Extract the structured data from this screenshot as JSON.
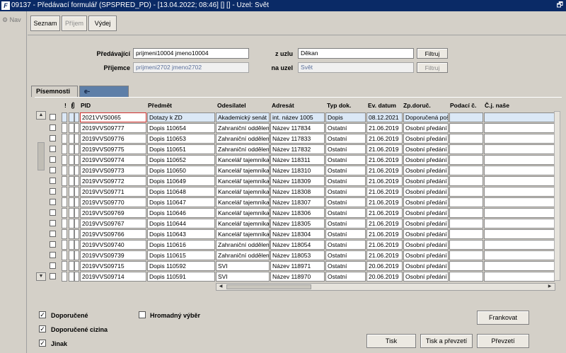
{
  "window": {
    "title": "09137 - Předávací formulář (SPSPRED_PD) - [13.04.2022; 08:46] [] [] - Uzel: Svět",
    "icon_label": "F"
  },
  "leftnav": {
    "label": "Nav"
  },
  "toolbar": {
    "seznam": "Seznam",
    "prijem": "Příjem",
    "vydej": "Výdej"
  },
  "form": {
    "predavajici_label": "Předávající",
    "predavajici_value": "prijmeni10004 jmeno10004",
    "prijemce_label": "Příjemce",
    "prijemce_value": "prijmeni2702 jmeno2702",
    "zuzlu_label": "z uzlu",
    "zuzlu_value": "Děkan",
    "nauzel_label": "na uzel",
    "nauzel_value": "Svět",
    "filtruj1": "Filtruj",
    "filtruj2": "Filtruj"
  },
  "tabs": [
    {
      "label": "Písemnosti"
    },
    {
      "label": "e-Dokumenty"
    }
  ],
  "columns": {
    "flag": "!",
    "pid": "PID",
    "predmet": "Předmět",
    "odesilatel": "Odesílatel",
    "adresat": "Adresát",
    "typ": "Typ dok.",
    "evdatum": "Ev. datum",
    "zpdoruc": "Zp.doruč.",
    "podaci": "Podací č.",
    "cjnase": "Č.j. naše"
  },
  "rows": [
    {
      "pid": "2021VVS0065",
      "predmet": "Dotazy k ZD",
      "odesilatel": "Akademický senát",
      "adresat": "int. název 1005",
      "typ": "Dopis",
      "datum": "08.12.2021",
      "zp": "Doporučená poš"
    },
    {
      "pid": "2019VVS09777",
      "predmet": "Dopis 110654",
      "odesilatel": "Zahraniční oddělení",
      "adresat": "Název 117834",
      "typ": "Ostatní",
      "datum": "21.06.2019",
      "zp": "Osobní předání"
    },
    {
      "pid": "2019VVS09776",
      "predmet": "Dopis 110653",
      "odesilatel": "Zahraniční oddělení",
      "adresat": "Název 117833",
      "typ": "Ostatní",
      "datum": "21.06.2019",
      "zp": "Osobní předání"
    },
    {
      "pid": "2019VVS09775",
      "predmet": "Dopis 110651",
      "odesilatel": "Zahraniční oddělení",
      "adresat": "Název 117832",
      "typ": "Ostatní",
      "datum": "21.06.2019",
      "zp": "Osobní předání"
    },
    {
      "pid": "2019VVS09774",
      "predmet": "Dopis 110652",
      "odesilatel": "Kancelář tajemníka",
      "adresat": "Název 118311",
      "typ": "Ostatní",
      "datum": "21.06.2019",
      "zp": "Osobní předání"
    },
    {
      "pid": "2019VVS09773",
      "predmet": "Dopis 110650",
      "odesilatel": "Kancelář tajemníka",
      "adresat": "Název 118310",
      "typ": "Ostatní",
      "datum": "21.06.2019",
      "zp": "Osobní předání"
    },
    {
      "pid": "2019VVS09772",
      "predmet": "Dopis 110649",
      "odesilatel": "Kancelář tajemníka",
      "adresat": "Název 118309",
      "typ": "Ostatní",
      "datum": "21.06.2019",
      "zp": "Osobní předání"
    },
    {
      "pid": "2019VVS09771",
      "predmet": "Dopis 110648",
      "odesilatel": "Kancelář tajemníka",
      "adresat": "Název 118308",
      "typ": "Ostatní",
      "datum": "21.06.2019",
      "zp": "Osobní předání"
    },
    {
      "pid": "2019VVS09770",
      "predmet": "Dopis 110647",
      "odesilatel": "Kancelář tajemníka",
      "adresat": "Název 118307",
      "typ": "Ostatní",
      "datum": "21.06.2019",
      "zp": "Osobní předání"
    },
    {
      "pid": "2019VVS09769",
      "predmet": "Dopis 110646",
      "odesilatel": "Kancelář tajemníka",
      "adresat": "Název 118306",
      "typ": "Ostatní",
      "datum": "21.06.2019",
      "zp": "Osobní předání"
    },
    {
      "pid": "2019VVS09767",
      "predmet": "Dopis 110644",
      "odesilatel": "Kancelář tajemníka",
      "adresat": "Název 118305",
      "typ": "Ostatní",
      "datum": "21.06.2019",
      "zp": "Osobní předání"
    },
    {
      "pid": "2019VVS09766",
      "predmet": "Dopis 110643",
      "odesilatel": "Kancelář tajemníka",
      "adresat": "Název 118304",
      "typ": "Ostatní",
      "datum": "21.06.2019",
      "zp": "Osobní předání"
    },
    {
      "pid": "2019VVS09740",
      "predmet": "Dopis 110616",
      "odesilatel": "Zahraniční oddělení",
      "adresat": "Název 118054",
      "typ": "Ostatní",
      "datum": "21.06.2019",
      "zp": "Osobní předání"
    },
    {
      "pid": "2019VVS09739",
      "predmet": "Dopis 110615",
      "odesilatel": "Zahraniční oddělení",
      "adresat": "Název 118053",
      "typ": "Ostatní",
      "datum": "21.06.2019",
      "zp": "Osobní předání"
    },
    {
      "pid": "2019VVS09715",
      "predmet": "Dopis 110592",
      "odesilatel": "SVI",
      "adresat": "Název 118971",
      "typ": "Ostatní",
      "datum": "20.06.2019",
      "zp": "Osobní předání"
    },
    {
      "pid": "2019VVS09714",
      "predmet": "Dopis 110591",
      "odesilatel": "SVI",
      "adresat": "Název 118970",
      "typ": "Ostatní",
      "datum": "20.06.2019",
      "zp": "Osobní předání"
    }
  ],
  "bottom": {
    "doporucene": "Doporučené",
    "doporucene_cizina": "Doporučené cizina",
    "jinak": "Jinak",
    "hromadny": "Hromadný výběr",
    "checkmark": "✓",
    "frankovat": "Frankovat",
    "tisk": "Tisk",
    "tisk_prevzeti": "Tisk a převzetí",
    "prevzeti": "Převzetí"
  },
  "colors": {
    "titlebar": "#0a2a66",
    "tab_inactive": "#5e7fa8",
    "selected_row": "#dbe8f6"
  }
}
